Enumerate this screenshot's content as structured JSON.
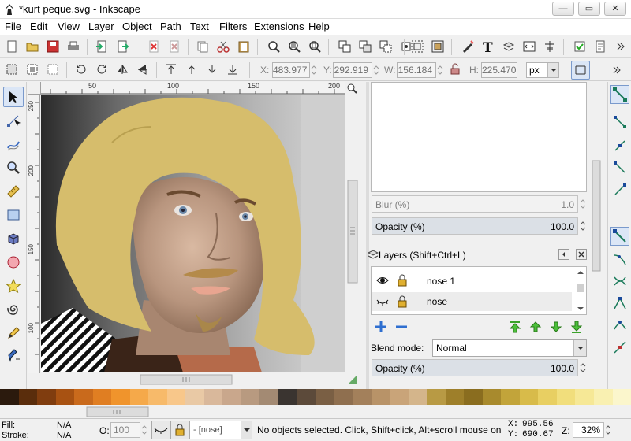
{
  "window": {
    "title": "*kurt peque.svg - Inkscape",
    "minimize": "—",
    "maximize": "▭",
    "close": "✕"
  },
  "menubar": {
    "items": [
      {
        "label": "File",
        "u": "F",
        "rest": "ile"
      },
      {
        "label": "Edit",
        "u": "E",
        "rest": "dit"
      },
      {
        "label": "View",
        "u": "V",
        "rest": "iew"
      },
      {
        "label": "Layer",
        "u": "L",
        "rest": "ayer"
      },
      {
        "label": "Object",
        "u": "O",
        "rest": "bject"
      },
      {
        "label": "Path",
        "u": "P",
        "rest": "ath"
      },
      {
        "label": "Text",
        "u": "T",
        "rest": "ext"
      },
      {
        "label": "Filters",
        "u": "F",
        "rest": "ilters"
      },
      {
        "label": "Extensions",
        "u": "x",
        "pre": "E",
        "rest": "tensions"
      },
      {
        "label": "Help",
        "u": "H",
        "rest": "elp"
      }
    ]
  },
  "selection_toolbar": {
    "x_label": "X:",
    "x_value": "483.977",
    "y_label": "Y:",
    "y_value": "292.919",
    "w_label": "W:",
    "w_value": "156.184",
    "h_label": "H:",
    "h_value": "225.470",
    "unit": "px"
  },
  "ruler": {
    "h_ticks": [
      "50",
      "100",
      "150",
      "200"
    ],
    "v_ticks": [
      "250",
      "200",
      "150",
      "100"
    ]
  },
  "fill_stroke": {
    "blur_label": "Blur (%)",
    "blur_value": "1.0",
    "opacity_label": "Opacity (%)",
    "opacity_value": "100.0"
  },
  "layers_panel": {
    "title": "Layers (Shift+Ctrl+L)",
    "layers": [
      {
        "name": "nose 1",
        "visible": true,
        "locked": true
      },
      {
        "name": "nose",
        "visible": false,
        "locked": true
      }
    ],
    "blend_label": "Blend mode:",
    "blend_value": "Normal",
    "opacity_label": "Opacity (%)",
    "opacity_value": "100.0"
  },
  "palette": {
    "colors": [
      "#2b1a0d",
      "#5a2d0c",
      "#803d0f",
      "#a85212",
      "#c96a1c",
      "#e07e22",
      "#f0942c",
      "#f5a94a",
      "#f7ba6a",
      "#f8c78a",
      "#e9c9a5",
      "#d9b89b",
      "#c9a78c",
      "#b89a80",
      "#a38a73",
      "#3a3430",
      "#5c4a3a",
      "#7a5f44",
      "#8f6f4f",
      "#a3805b",
      "#b89368",
      "#c9a479",
      "#d4b58b",
      "#b89a44",
      "#9e7f2a",
      "#8a6d1f",
      "#a88a2d",
      "#c2a43a",
      "#d8bb4a",
      "#e8cf62",
      "#f1de7c",
      "#f6e896",
      "#f9f0b1",
      "#fbf6cc"
    ]
  },
  "statusbar": {
    "fill_label": "Fill:",
    "fill_value": "N/A",
    "stroke_label": "Stroke:",
    "stroke_value": "N/A",
    "opacity_label": "O:",
    "opacity_value": "100",
    "layer_value": "- [nose]",
    "message": "No objects selected. Click, Shift+click, Alt+scroll mouse on",
    "x_label": "X:",
    "x_value": "995.56",
    "y_label": "Y:",
    "y_value": "690.67",
    "zoom_label": "Z:",
    "zoom_value": "32%"
  }
}
